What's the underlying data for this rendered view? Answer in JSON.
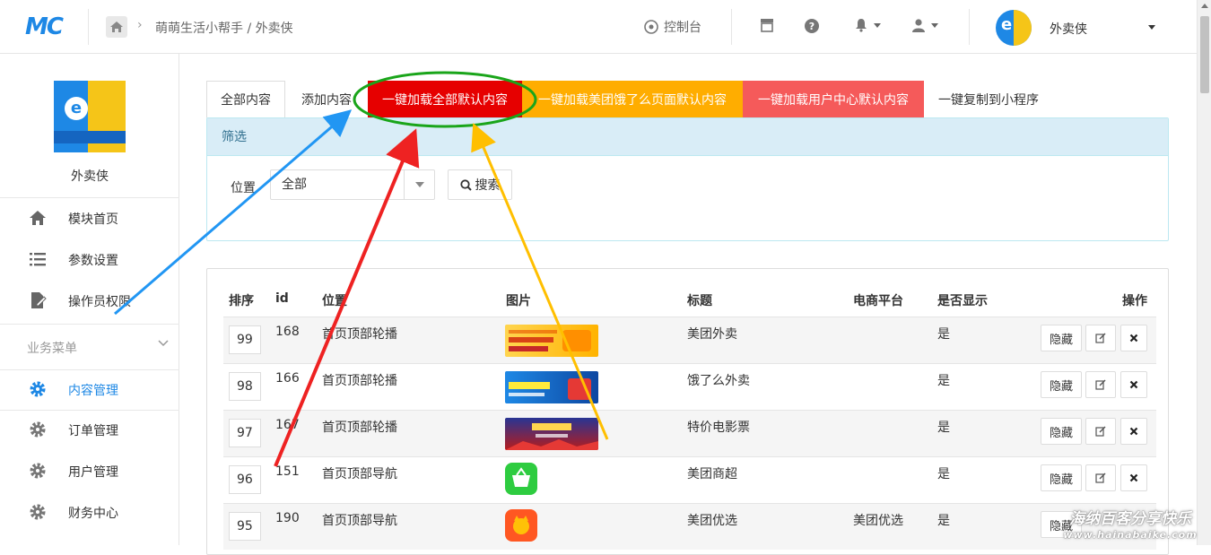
{
  "header": {
    "logo_text": "MC",
    "breadcrumb": "萌萌生活小帮手 / 外卖侠",
    "console_label": "控制台",
    "user_name": "外卖侠"
  },
  "sidebar": {
    "shop_name": "外卖侠",
    "items": [
      {
        "label": "模块首页",
        "icon": "home-icon"
      },
      {
        "label": "参数设置",
        "icon": "list-icon"
      },
      {
        "label": "操作员权限",
        "icon": "doc-edit-icon"
      }
    ],
    "group_title": "业务菜单",
    "group_items": [
      {
        "label": "内容管理",
        "icon": "gear-icon",
        "active": true
      },
      {
        "label": "订单管理",
        "icon": "gear-icon"
      },
      {
        "label": "用户管理",
        "icon": "gear-icon"
      },
      {
        "label": "财务中心",
        "icon": "gear-icon"
      }
    ]
  },
  "tabs": {
    "all": "全部内容",
    "add": "添加内容",
    "load_all": "一键加载全部默认内容",
    "load_meituan": "一键加载美团饿了么页面默认内容",
    "load_user": "一键加载用户中心默认内容",
    "copy": "一键复制到小程序"
  },
  "filter": {
    "title": "筛选",
    "position_label": "位置",
    "position_value": "全部",
    "search_label": "搜索"
  },
  "table": {
    "headers": {
      "sort": "排序",
      "id": "id",
      "position": "位置",
      "image": "图片",
      "title": "标题",
      "platform": "电商平台",
      "visible": "是否显示",
      "ops": "操作"
    },
    "rows": [
      {
        "sort": "99",
        "id": "168",
        "position": "首页顶部轮播",
        "title": "美团外卖",
        "platform": "",
        "visible": "是",
        "hide": "隐藏"
      },
      {
        "sort": "98",
        "id": "166",
        "position": "首页顶部轮播",
        "title": "饿了么外卖",
        "platform": "",
        "visible": "是",
        "hide": "隐藏"
      },
      {
        "sort": "97",
        "id": "167",
        "position": "首页顶部轮播",
        "title": "特价电影票",
        "platform": "",
        "visible": "是",
        "hide": "隐藏"
      },
      {
        "sort": "96",
        "id": "151",
        "position": "首页顶部导航",
        "title": "美团商超",
        "platform": "",
        "visible": "是",
        "hide": "隐藏"
      },
      {
        "sort": "95",
        "id": "190",
        "position": "首页顶部导航",
        "title": "美团优选",
        "platform": "美团优选",
        "visible": "是",
        "hide": "隐藏"
      }
    ]
  },
  "watermark": {
    "line1": "海纳百客分享快乐",
    "line2": "www.hainabaike.com"
  },
  "colors": {
    "accent": "#1e88e5",
    "red_tab": "#e60000",
    "orange_tab": "#ffad00",
    "pink_tab": "#f55a5a",
    "annotation_green": "#1aa51a",
    "annotation_blue": "#2196f3",
    "annotation_red": "#ee2222",
    "annotation_yellow": "#ffbf00"
  }
}
